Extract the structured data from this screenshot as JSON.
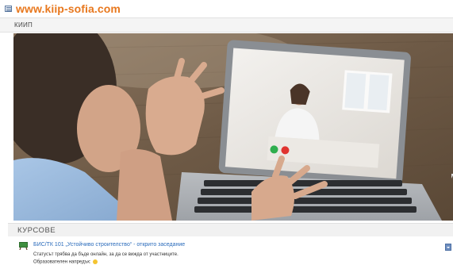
{
  "header": {
    "site_logo": "www.kiip-sofia.com"
  },
  "section": {
    "title": "КИИП"
  },
  "hero": {
    "alt": "Видеоконференция на лаптоп"
  },
  "courses": {
    "title": "КУРСОВЕ",
    "items": [
      {
        "link": "БИС/ТК 101 „Устойчиво строителство“ - открито заседание",
        "status": "Статусът трябва да бъде онлайн, за да се вижда от участниците.",
        "direction": "Образователен напредък:"
      }
    ]
  },
  "colors": {
    "logo": "#e8781e",
    "link": "#2a6bbb"
  }
}
